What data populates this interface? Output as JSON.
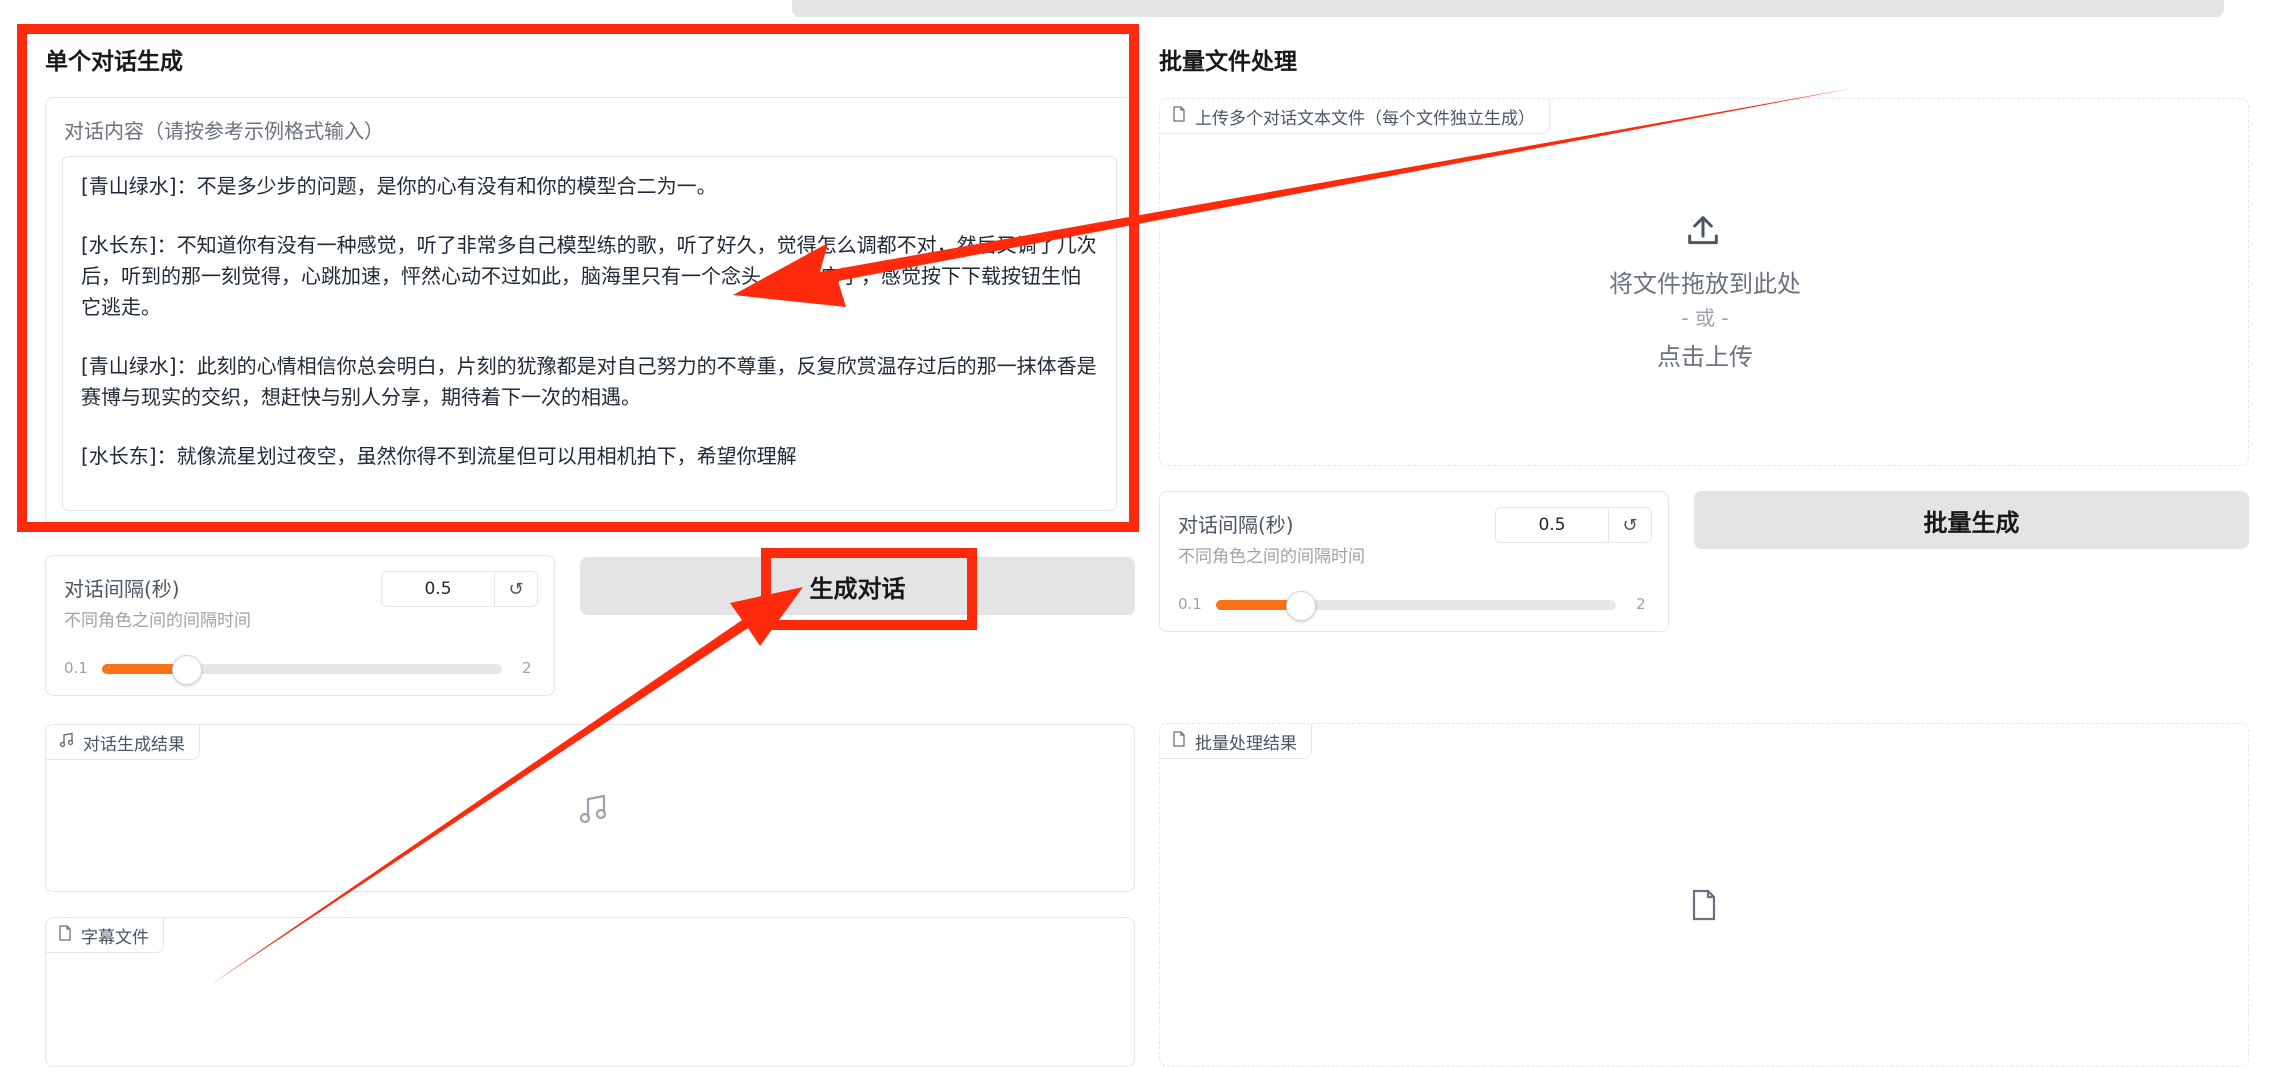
{
  "single": {
    "title": "单个对话生成",
    "input_label": "对话内容（请按参考示例格式输入）",
    "dialogue_lines": [
      "[青山绿水]：不是多少步的问题，是你的心有没有和你的模型合二为一。",
      "[水长东]：不知道你有没有一种感觉，听了非常多自己模型练的歌，听了好久，觉得怎么调都不对，然后又调了几次后，听到的那一刻觉得，心跳加速，怦然心动不过如此，脑海里只有一个念头，就是它了，感觉按下下载按钮生怕它逃走。",
      "[青山绿水]：此刻的心情相信你总会明白，片刻的犹豫都是对自己努力的不尊重，反复欣赏温存过后的那一抹体香是赛博与现实的交织，想赶快与别人分享，期待着下一次的相遇。",
      "[水长东]：就像流星划过夜空，虽然你得不到流星但可以用相机拍下，希望你理解"
    ],
    "interval": {
      "label": "对话间隔(秒)",
      "sub": "不同角色之间的间隔时间",
      "value": "0.5",
      "min": "0.1",
      "max": "2",
      "fraction": 0.21
    },
    "generate_button": "生成对话",
    "result_label": "对话生成结果",
    "subtitle_label": "字幕文件"
  },
  "batch": {
    "title": "批量文件处理",
    "upload_label": "上传多个对话文本文件（每个文件独立生成）",
    "drop_text": "将文件拖放到此处",
    "or_text": "- 或 -",
    "click_text": "点击上传",
    "interval": {
      "label": "对话间隔(秒)",
      "sub": "不同角色之间的间隔时间",
      "value": "0.5",
      "min": "0.1",
      "max": "2",
      "fraction": 0.21
    },
    "generate_button": "批量生成",
    "result_label": "批量处理结果"
  },
  "colors": {
    "accent": "#f97316",
    "annotation": "#ff2a0c"
  },
  "icons": [
    "reset-icon",
    "file-icon",
    "upload-icon",
    "music-note-icon"
  ]
}
